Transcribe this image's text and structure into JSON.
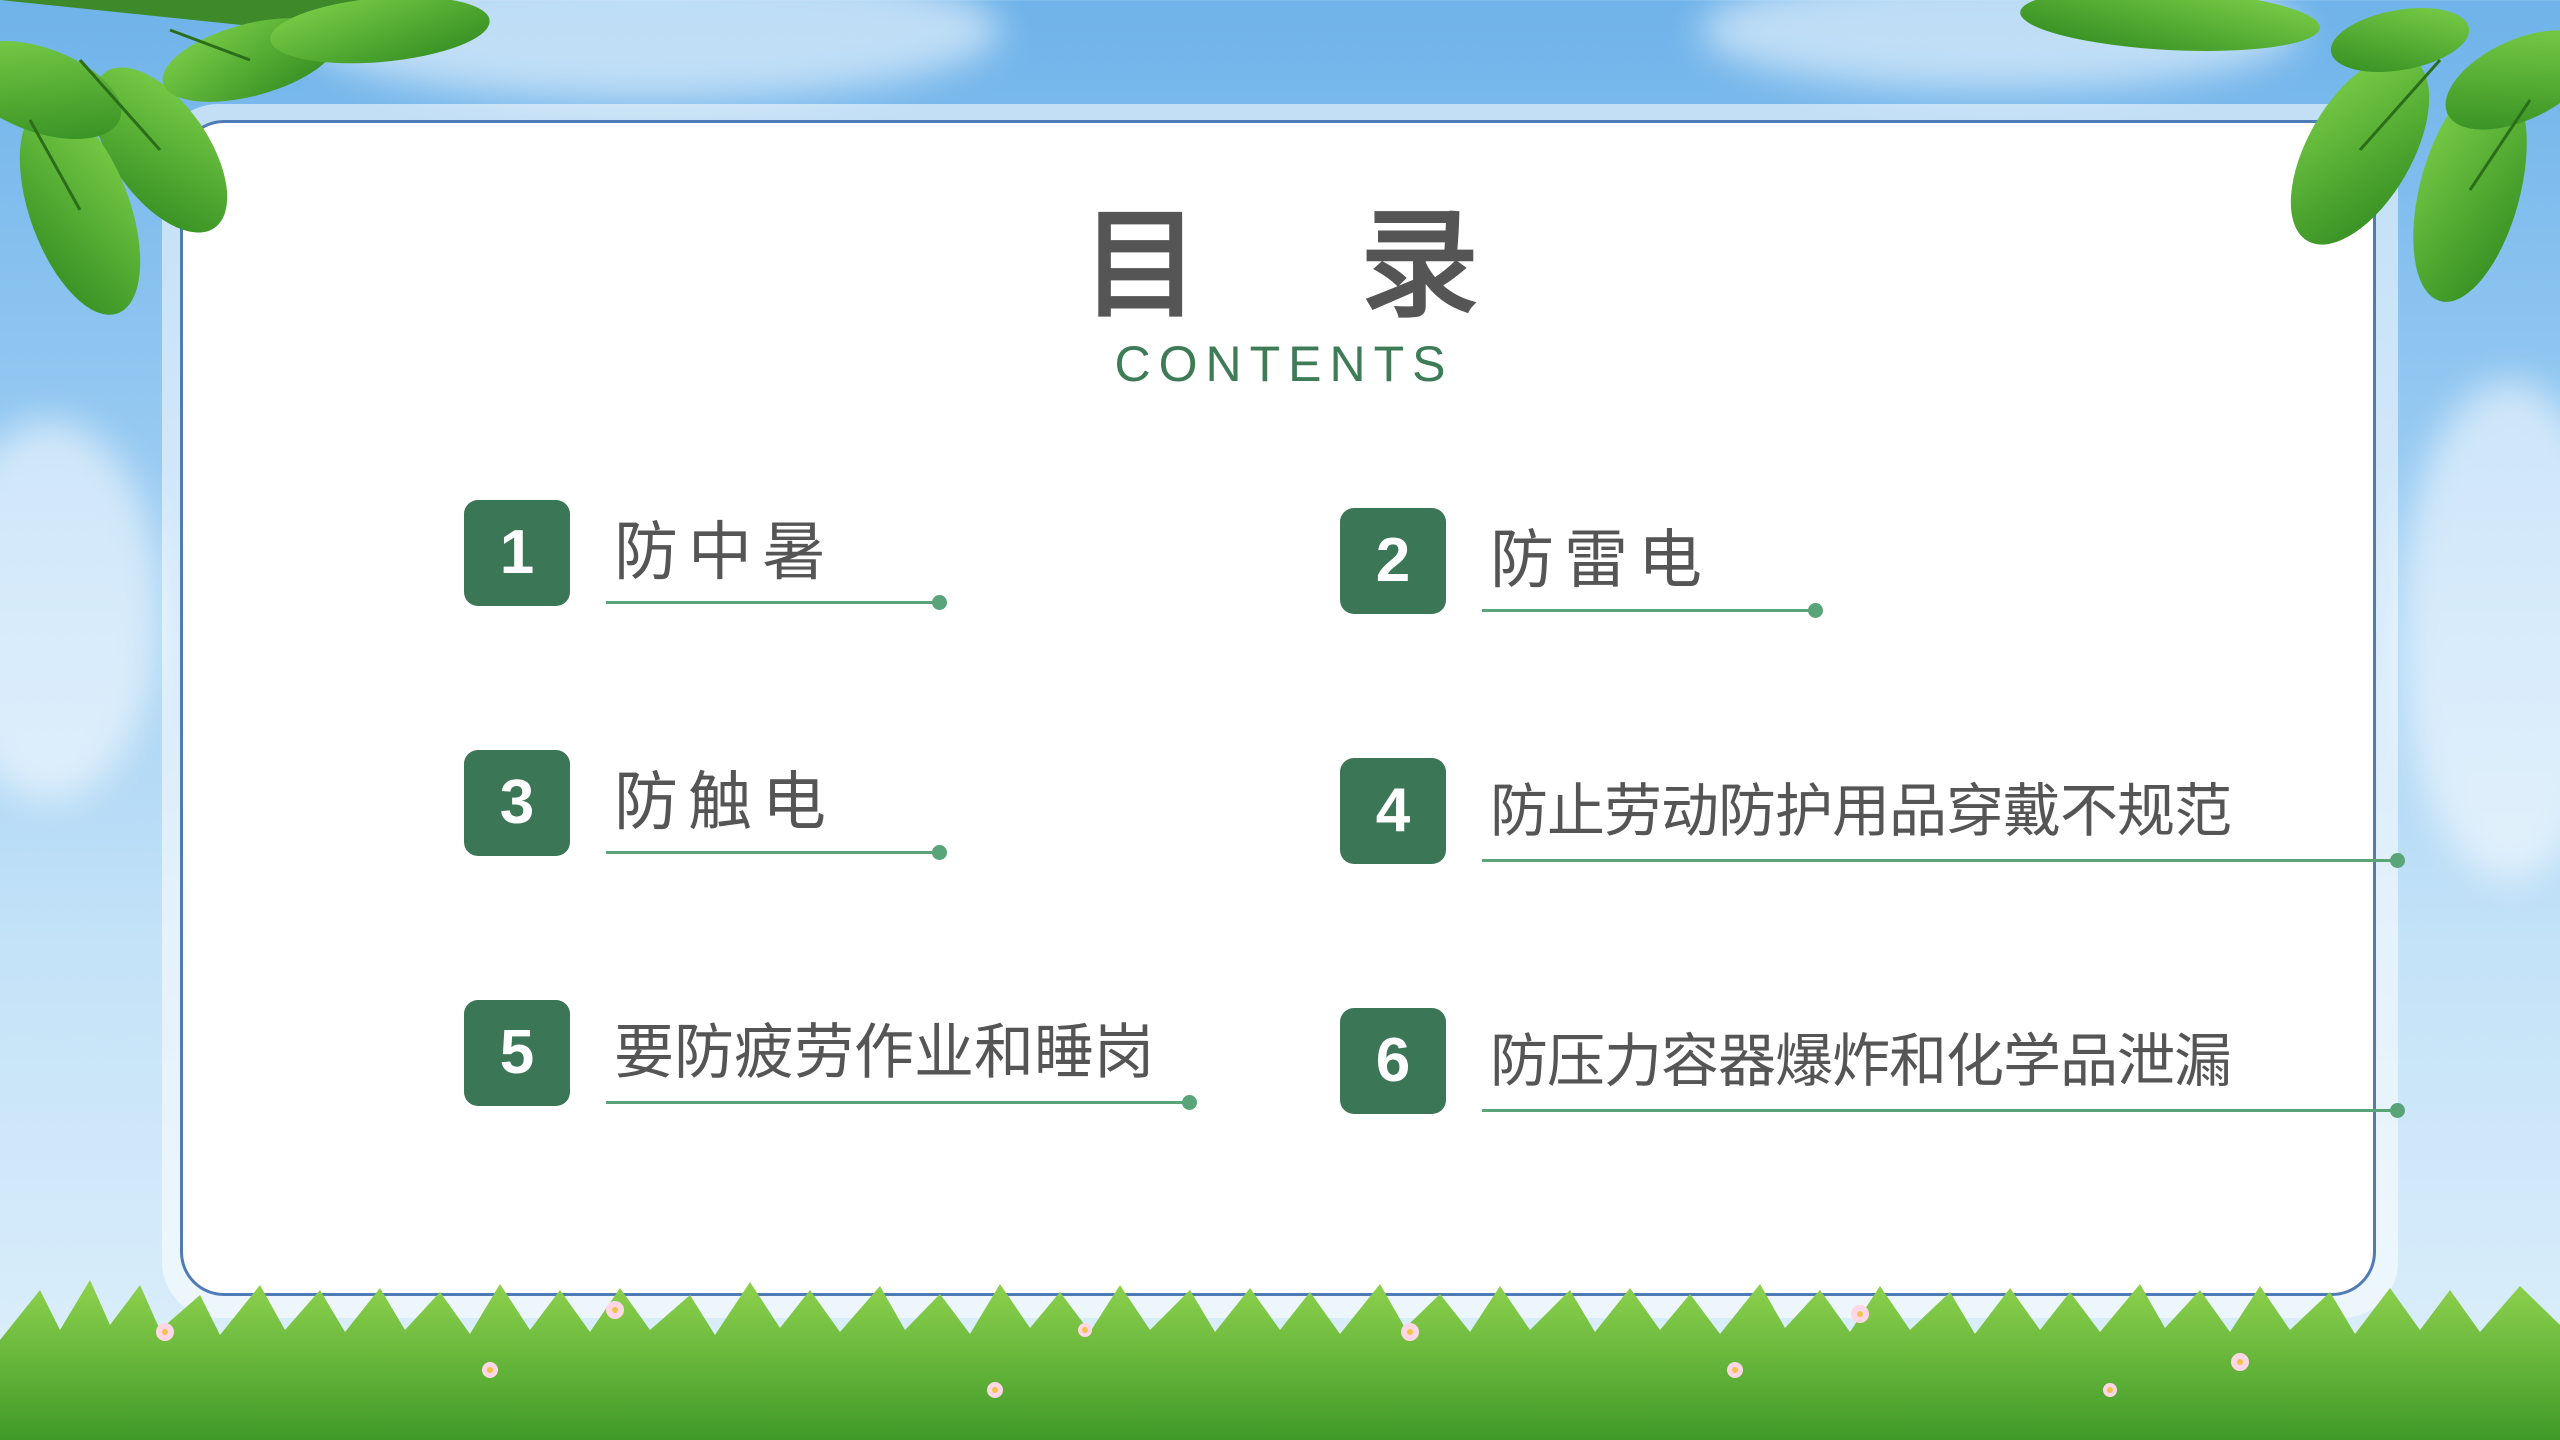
{
  "title": "目 录",
  "subtitle": "CONTENTS",
  "items": [
    {
      "number": "1",
      "label": "防中暑"
    },
    {
      "number": "2",
      "label": "防雷电"
    },
    {
      "number": "3",
      "label": "防触电"
    },
    {
      "number": "4",
      "label": "防止劳动防护用品穿戴不规范"
    },
    {
      "number": "5",
      "label": "要防疲劳作业和睡岗"
    },
    {
      "number": "6",
      "label": "防压力容器爆炸和化学品泄漏"
    }
  ],
  "colors": {
    "accent": "#3b7656",
    "underline": "#5aa47a",
    "text": "#555555",
    "frame": "#4f7bb7"
  },
  "decorations": [
    "leaf-icon",
    "grass-icon",
    "flower-icon",
    "cloud-icon"
  ]
}
